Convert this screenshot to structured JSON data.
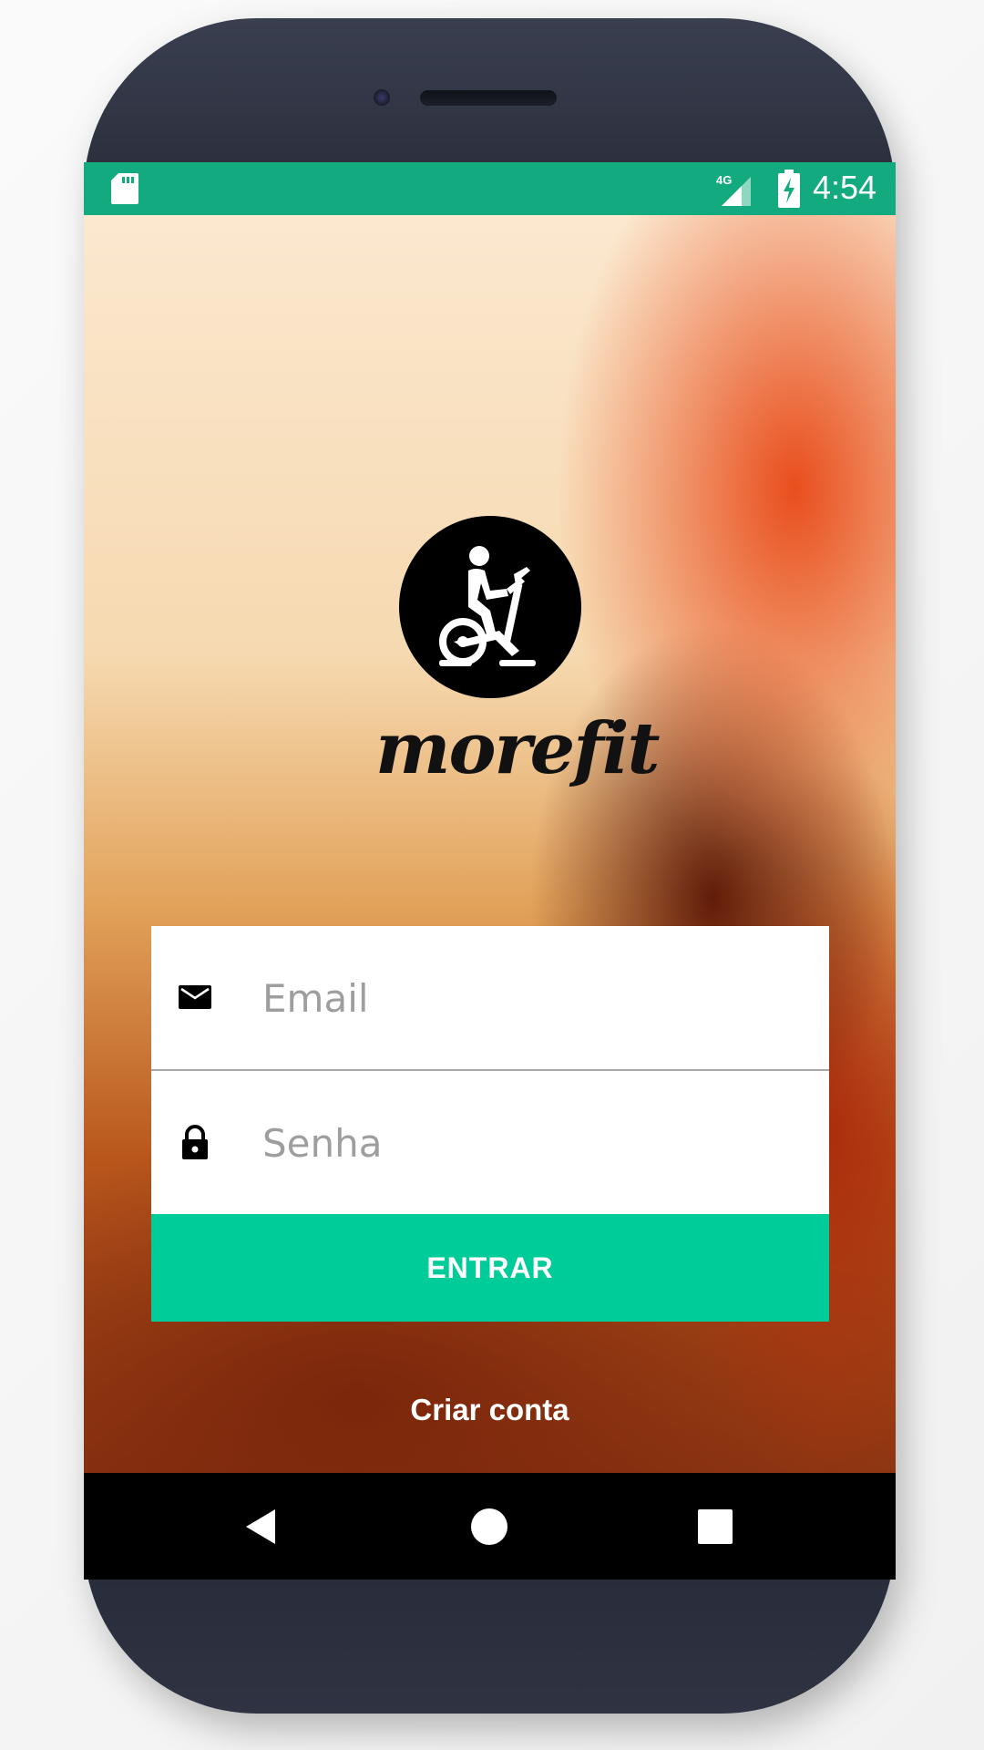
{
  "status_bar": {
    "network": "4G",
    "time": "4:54",
    "background_color": "#13aa7f"
  },
  "brand": {
    "name": "morefit",
    "logo_icon": "exercise-bike-icon"
  },
  "login_form": {
    "email": {
      "placeholder": "Email",
      "value": "",
      "icon": "mail-icon"
    },
    "password": {
      "placeholder": "Senha",
      "value": "",
      "icon": "lock-icon"
    },
    "submit_label": "ENTRAR",
    "submit_color": "#00cc99"
  },
  "create_account_label": "Criar conta",
  "nav_bar": {
    "back": "back-icon",
    "home": "home-icon",
    "recents": "recents-icon"
  }
}
